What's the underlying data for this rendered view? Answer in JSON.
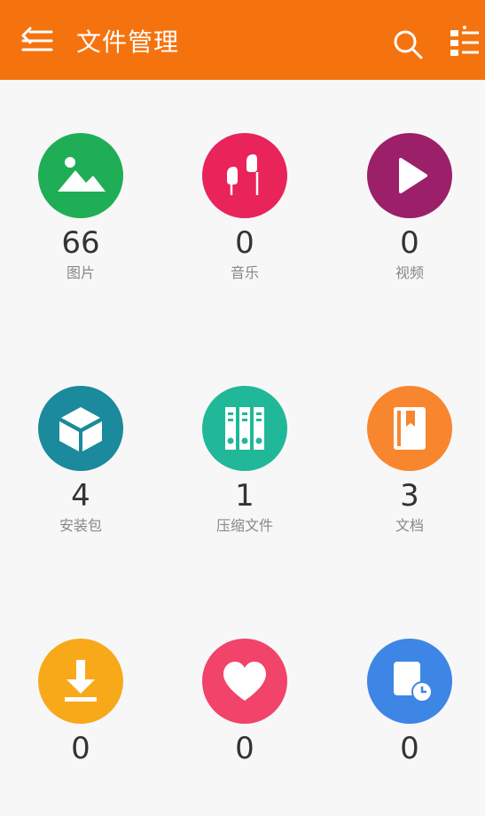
{
  "header": {
    "title": "文件管理",
    "background": "#f5730f",
    "menu_icon": "menu-back-icon",
    "search_icon": "search-icon",
    "sort_icon": "list-sort-icon"
  },
  "categories": [
    {
      "label": "图片",
      "count": "66",
      "icon": "image-icon",
      "color": "#1fae55"
    },
    {
      "label": "音乐",
      "count": "0",
      "icon": "earphones-icon",
      "color": "#e8245a"
    },
    {
      "label": "视频",
      "count": "0",
      "icon": "play-icon",
      "color": "#9c1f6a"
    },
    {
      "label": "安装包",
      "count": "4",
      "icon": "box-icon",
      "color": "#1a8a9c"
    },
    {
      "label": "压缩文件",
      "count": "1",
      "icon": "archive-binders-icon",
      "color": "#20b898"
    },
    {
      "label": "文档",
      "count": "3",
      "icon": "document-icon",
      "color": "#f7862f"
    },
    {
      "label": "",
      "count": "0",
      "icon": "download-icon",
      "color": "#f8a91a"
    },
    {
      "label": "",
      "count": "0",
      "icon": "heart-icon",
      "color": "#f2436a"
    },
    {
      "label": "",
      "count": "0",
      "icon": "recent-file-clock-icon",
      "color": "#3d86e6"
    }
  ]
}
